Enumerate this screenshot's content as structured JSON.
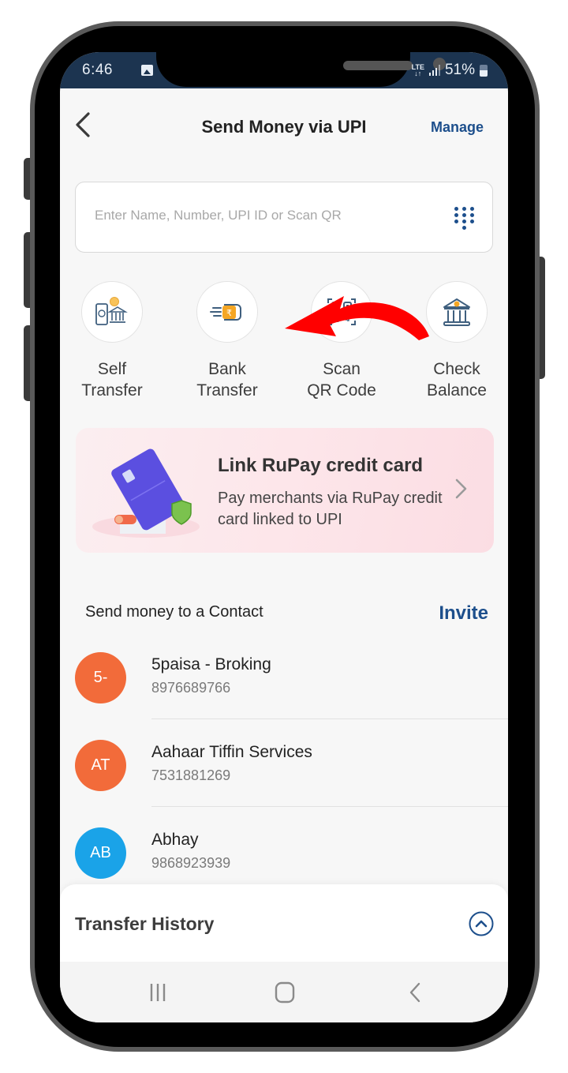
{
  "status_bar": {
    "time": "6:46",
    "network": "LTE",
    "battery": "51%",
    "icons": [
      "gallery-icon",
      "lte-icon",
      "signal-icon",
      "battery-icon"
    ]
  },
  "header": {
    "back_icon": "chevron-left-icon",
    "title": "Send Money via UPI",
    "manage_label": "Manage"
  },
  "search": {
    "value": "",
    "placeholder": "Enter Name, Number, UPI ID or Scan QR",
    "icon": "dialpad-icon"
  },
  "quick_actions": [
    {
      "line1": "Self",
      "line2": "Transfer",
      "icon": "phone-to-bank-icon"
    },
    {
      "line1": "Bank",
      "line2": "Transfer",
      "icon": "fast-money-icon"
    },
    {
      "line1": "Scan",
      "line2": "QR Code",
      "icon": "qr-scan-icon"
    },
    {
      "line1": "Check",
      "line2": "Balance",
      "icon": "bank-icon"
    }
  ],
  "promo": {
    "title": "Link RuPay credit card",
    "subtitle": "Pay merchants via RuPay credit card linked to UPI",
    "icon": "credit-card-icon"
  },
  "contacts": {
    "heading": "Send money to a Contact",
    "invite_label": "Invite",
    "items": [
      {
        "initials": "5-",
        "name": "5paisa - Broking",
        "phone": "8976689766",
        "color": "#f26b3a"
      },
      {
        "initials": "AT",
        "name": "Aahaar Tiffin Services",
        "phone": "7531881269",
        "color": "#f26b3a"
      },
      {
        "initials": "AB",
        "name": "Abhay",
        "phone": "9868923939",
        "color": "#1aa3e8"
      }
    ]
  },
  "transfer_history": {
    "title": "Transfer History",
    "toggle_icon": "chevron-up-circle-icon"
  },
  "nav": {
    "recents_icon": "recents-icon",
    "home_icon": "home-icon",
    "back_icon": "back-icon"
  },
  "colors": {
    "accent": "#1d4f8c",
    "status_bar": "#1c3450",
    "orange_avatar": "#f26b3a",
    "blue_avatar": "#1aa3e8",
    "annotation_arrow": "#ff0000"
  }
}
